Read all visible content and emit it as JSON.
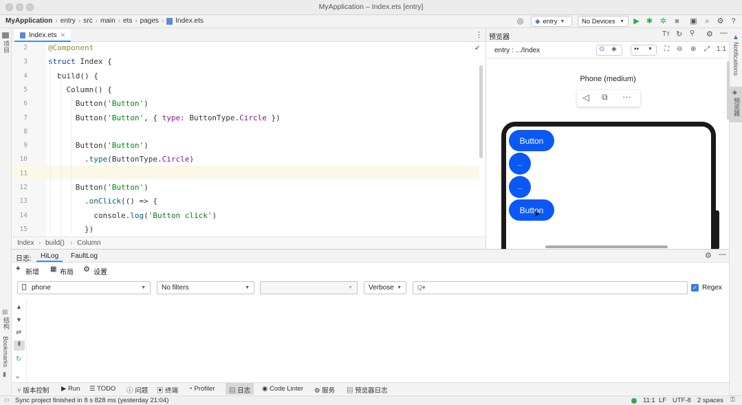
{
  "window": {
    "title": "MyApplication – Index.ets [entry]"
  },
  "breadcrumb": [
    "MyApplication",
    "entry",
    "src",
    "main",
    "ets",
    "pages",
    "Index.ets"
  ],
  "toolbar": {
    "module": "entry",
    "device": "No Devices"
  },
  "left_strip": {
    "project": "项目",
    "structure": "结构",
    "bookmarks": "Bookmarks"
  },
  "right_strip": {
    "notifications": "Notifications",
    "previewer": "预览器"
  },
  "editor": {
    "tab": "Index.ets",
    "lines": [
      {
        "n": "2",
        "parts": [
          [
            "@Component",
            "#8c8c3c"
          ]
        ]
      },
      {
        "n": "3",
        "parts": [
          [
            "struct",
            "#0033b3"
          ],
          [
            " Index {",
            "#333"
          ]
        ]
      },
      {
        "n": "4",
        "parts": [
          [
            "  build() {",
            "#333"
          ]
        ]
      },
      {
        "n": "5",
        "parts": [
          [
            "    Column() {",
            "#333"
          ]
        ]
      },
      {
        "n": "6",
        "parts": [
          [
            "      Button(",
            "#333"
          ],
          [
            "'Button'",
            "#067d17"
          ],
          [
            ")",
            "#333"
          ]
        ]
      },
      {
        "n": "7",
        "parts": [
          [
            "      Button(",
            "#333"
          ],
          [
            "'Button'",
            "#067d17"
          ],
          [
            ", { ",
            "#333"
          ],
          [
            "type",
            "#871094"
          ],
          [
            ": ButtonType.",
            "#333"
          ],
          [
            "Circle",
            "#871094"
          ],
          [
            " })",
            "#333"
          ]
        ]
      },
      {
        "n": "8",
        "parts": []
      },
      {
        "n": "9",
        "parts": [
          [
            "      Button(",
            "#333"
          ],
          [
            "'Button'",
            "#067d17"
          ],
          [
            ")",
            "#333"
          ]
        ]
      },
      {
        "n": "10",
        "parts": [
          [
            "        .",
            "#333"
          ],
          [
            "type",
            "#00627a"
          ],
          [
            "(ButtonType.",
            "#333"
          ],
          [
            "Circle",
            "#871094"
          ],
          [
            ")",
            "#333"
          ]
        ]
      },
      {
        "n": "11",
        "parts": []
      },
      {
        "n": "12",
        "parts": [
          [
            "      Button(",
            "#333"
          ],
          [
            "'Button'",
            "#067d17"
          ],
          [
            ")",
            "#333"
          ]
        ]
      },
      {
        "n": "13",
        "parts": [
          [
            "        .",
            "#333"
          ],
          [
            "onClick",
            "#00627a"
          ],
          [
            "(() => {",
            "#333"
          ]
        ]
      },
      {
        "n": "14",
        "parts": [
          [
            "          console.",
            "#333"
          ],
          [
            "log",
            "#00627a"
          ],
          [
            "(",
            "#333"
          ],
          [
            "'Button click'",
            "#067d17"
          ],
          [
            ")",
            "#333"
          ]
        ]
      },
      {
        "n": "15",
        "parts": [
          [
            "        })",
            "#333"
          ]
        ]
      }
    ],
    "path": [
      "Index",
      "build()",
      "Column"
    ]
  },
  "preview": {
    "title": "预览器",
    "route": "entry : .../Index",
    "device_label": "Phone (medium)",
    "buttons": [
      "Button",
      "...",
      "...",
      "Button"
    ]
  },
  "log": {
    "tabs": [
      "日志:",
      "HiLog",
      "FaultLog"
    ],
    "actions": [
      "新增",
      "布局",
      "设置"
    ],
    "device": "phone",
    "filter": "No filters",
    "level": "Verbose",
    "search_placeholder": "Q▾",
    "regex_label": "Regex"
  },
  "bottom_tabs": [
    "版本控制",
    "Run",
    "TODO",
    "问题",
    "终端",
    "Profiler",
    "日志",
    "Code Linter",
    "服务",
    "预览器日志"
  ],
  "status": {
    "message": "Sync project finished in 8 s 828 ms (yesterday 21:04)",
    "position": "11:1",
    "line_sep": "LF",
    "encoding": "UTF-8",
    "indent": "2 spaces"
  },
  "colors": {
    "accent": "#0a59f7",
    "tab_underline": "#4a88f0",
    "run_green": "#2fa84f",
    "current_line": "#fbf8e8"
  }
}
